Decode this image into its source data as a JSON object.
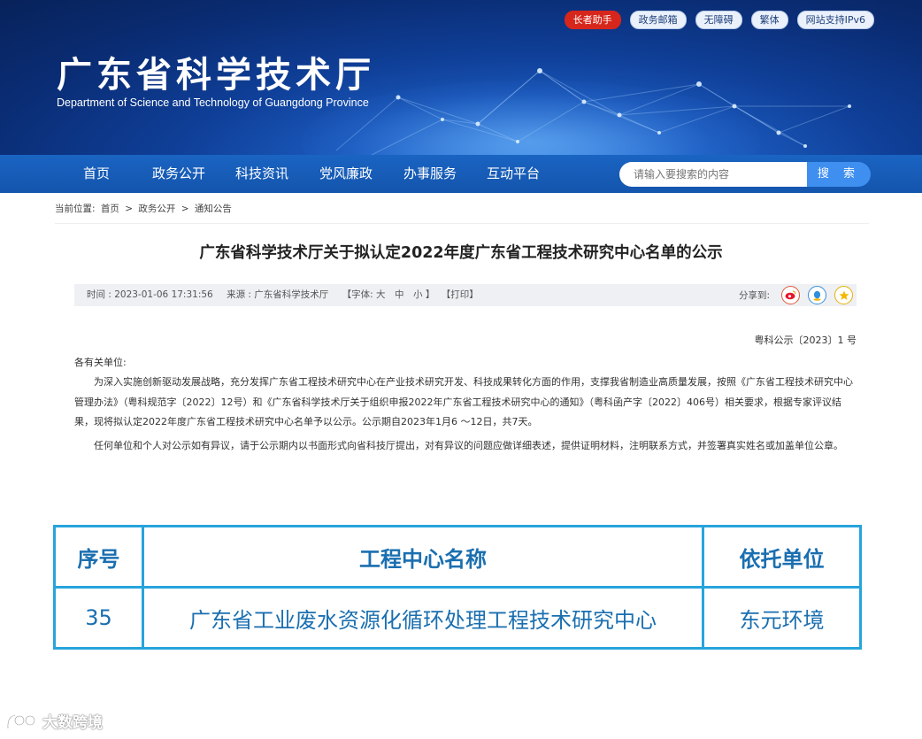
{
  "header": {
    "title": "广东省科学技术厅",
    "subtitle": "Department of Science and Technology of Guangdong Province",
    "top_links": [
      "长者助手",
      "政务邮箱",
      "无障碍",
      "繁体",
      "网站支持IPv6"
    ]
  },
  "nav": {
    "items": [
      "首页",
      "政务公开",
      "科技资讯",
      "党风廉政",
      "办事服务",
      "互动平台"
    ],
    "search_placeholder": "请输入要搜索的内容",
    "search_button": "搜 索"
  },
  "breadcrumb": {
    "label": "当前位置:",
    "items": [
      "首页",
      ">",
      "政务公开",
      ">",
      "通知公告"
    ]
  },
  "article": {
    "title": "广东省科学技术厅关于拟认定2022年度广东省工程技术研究中心名单的公示",
    "time": "时间 : 2023-01-06 17:31:56",
    "source": "来源 : 广东省科学技术厅",
    "font_size": "【字体: 大　中　小 】",
    "print": "【打印】",
    "share_label": "分享到:",
    "doc_number": "粤科公示〔2023〕1 号",
    "greeting": "各有关单位:",
    "paragraph1": "为深入实施创新驱动发展战略，充分发挥广东省工程技术研究中心在产业技术研究开发、科技成果转化方面的作用，支撑我省制造业高质量发展，按照《广东省工程技术研究中心管理办法》（粤科规范字〔2022〕12号）和《广东省科学技术厅关于组织申报2022年广东省工程技术研究中心的通知》（粤科函产字〔2022〕406号）相关要求，根据专家评议结果，现将拟认定2022年度广东省工程技术研究中心名单予以公示。公示期自2023年1月6 ～12日，共7天。",
    "paragraph2": "任何单位和个人对公示如有异议，请于公示期内以书面形式向省科技厅提出，对有异议的问题应做详细表述，提供证明材料，注明联系方式，并签署真实姓名或加盖单位公章。"
  },
  "table": {
    "headers": [
      "序号",
      "工程中心名称",
      "依托单位"
    ],
    "rows": [
      [
        "35",
        "广东省工业废水资源化循环处理工程技术研究中心",
        "东元环境"
      ]
    ]
  },
  "watermark": {
    "text": "大数跨境"
  },
  "colors": {
    "banner_dark": "#0a2c73",
    "nav_blue": "#1a64c2",
    "search_button": "#3f8ff0",
    "table_border": "#27a4dc",
    "table_text": "#1a6fb0",
    "elder_badge": "#d7261b"
  }
}
